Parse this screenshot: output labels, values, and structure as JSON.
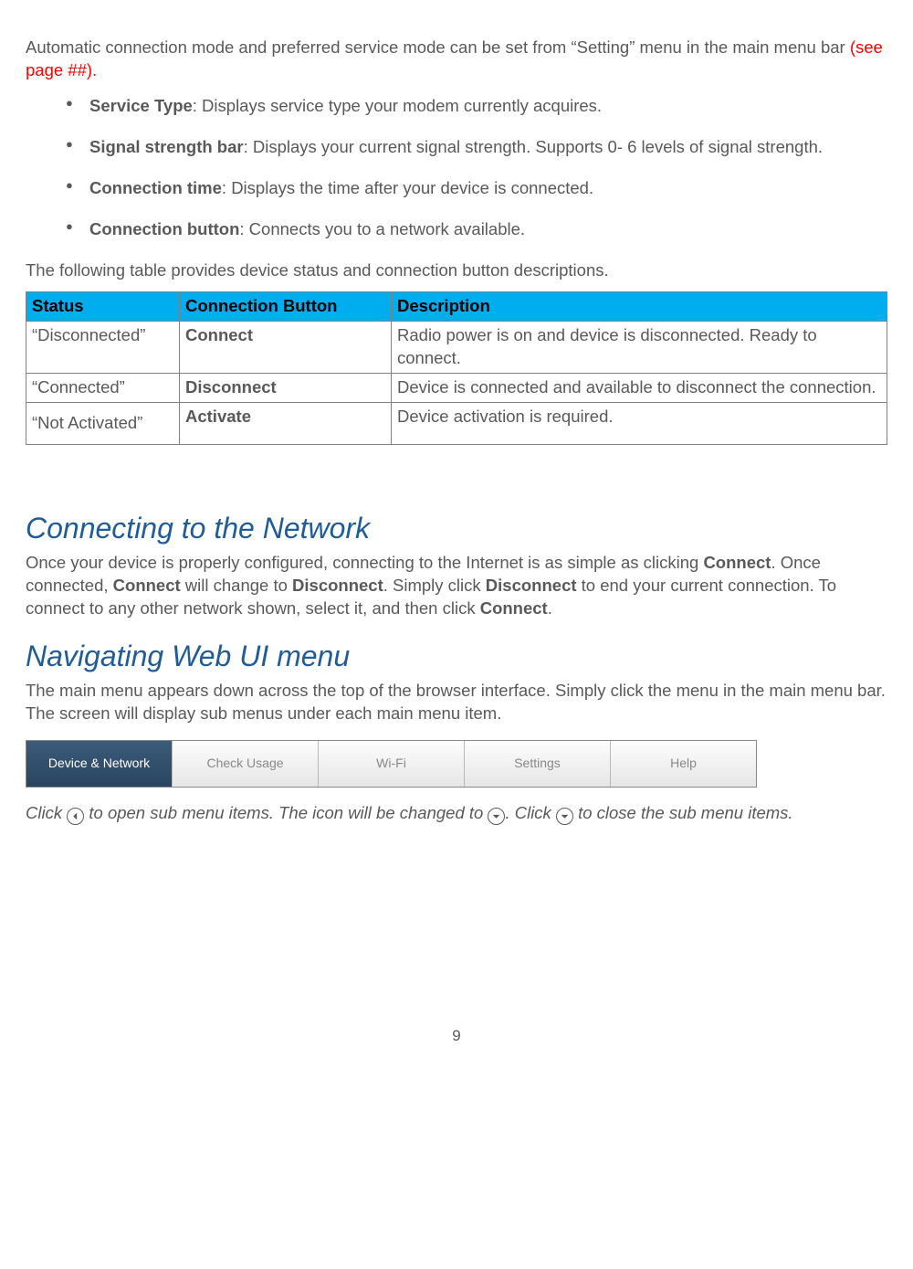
{
  "intro": {
    "line1": "Automatic connection mode and preferred service mode can be set from “Setting” menu in the main menu bar ",
    "red": "(see page ##)."
  },
  "bullets": [
    {
      "label": "Service Type",
      "desc": ": Displays service type your modem currently acquires."
    },
    {
      "label": "Signal strength bar",
      "desc": ": Displays your current signal strength. Supports 0- 6 levels of signal strength."
    },
    {
      "label": "Connection time",
      "desc": ": Displays the time after your device is connected."
    },
    {
      "label": "Connection button",
      "desc": ": Connects you to a network available."
    }
  ],
  "table_intro": "The following table provides device status and connection button descriptions.",
  "table": {
    "headers": [
      "Status",
      "Connection Button",
      "Description"
    ],
    "rows": [
      [
        "“Disconnected”",
        "Connect",
        "Radio power is on and device is disconnected. Ready to connect."
      ],
      [
        "“Connected”",
        "Disconnect",
        "Device is connected and available to disconnect the connection."
      ],
      [
        "“Not Activated”",
        "Activate",
        "Device activation is required."
      ]
    ]
  },
  "section1": {
    "title": "Connecting to the Network",
    "p_pre": "Once your device is properly configured, connecting to the Internet is as simple as clicking ",
    "b1": "Connect",
    "p_mid1": ".  Once connected, ",
    "b2": "Connect",
    "p_mid2": " will change to ",
    "b3": "Disconnect",
    "p_mid3": ". Simply click ",
    "b4": "Disconnect",
    "p_mid4": " to end your current connection. To connect to any other network shown, select it, and then click ",
    "b5": "Connect",
    "p_end": "."
  },
  "section2": {
    "title": "Navigating Web UI menu",
    "desc": "The main menu appears down across the top of the browser interface. Simply click the menu in the main menu bar. The screen will display sub menus under each main menu item."
  },
  "nav": [
    "Device & Network",
    "Check Usage",
    "Wi-Fi",
    "Settings",
    "Help"
  ],
  "note": {
    "p1": "Click ",
    "p2": " to open sub menu items. The icon will be changed to ",
    "p3": ". Click ",
    "p4": " to close the sub menu items."
  },
  "page_number": "9"
}
